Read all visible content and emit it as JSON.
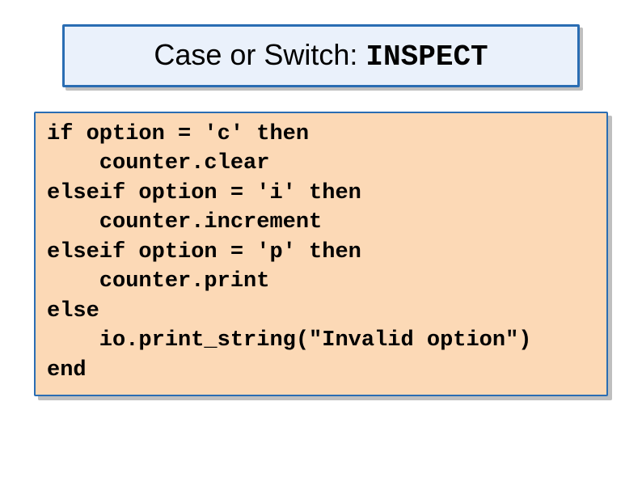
{
  "title": {
    "prefix": "Case or Switch: ",
    "keyword": "INSPECT"
  },
  "code": "if option = 'c' then\n    counter.clear\nelseif option = 'i' then\n    counter.increment\nelseif option = 'p' then\n    counter.print\nelse\n    io.print_string(\"Invalid option\")\nend"
}
